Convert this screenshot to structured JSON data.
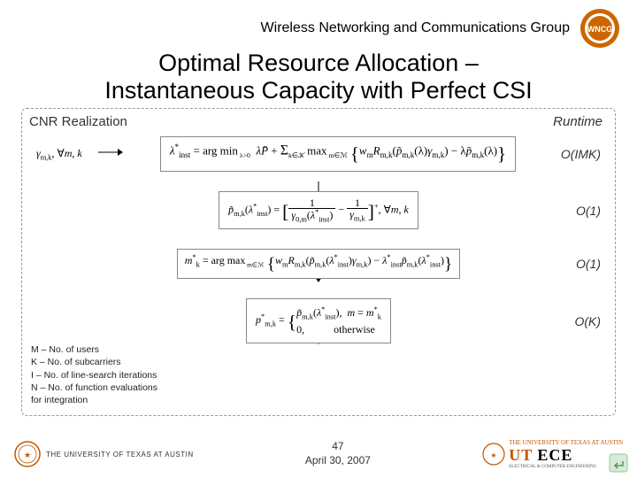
{
  "header": {
    "group_name": "Wireless Networking and Communications Group",
    "logo_label": "WNCG"
  },
  "title": {
    "line1": "Optimal Resource Allocation –",
    "line2": "Instantaneous Capacity with Perfect CSI"
  },
  "labels": {
    "cnr": "CNR Realization",
    "runtime": "Runtime"
  },
  "equations": {
    "eq1": {
      "text": "γₘ,ₖ, ∀m, k  →  λ*ᵢₙₛₜ = arg min  λP̄ + Σ  max { wₘ Rₘ,ₖ(p̃ₘ,ₖ(λ)γₘ,ₖ) − λ p̃ₘ,ₖ(λ) }   (λ>0, k∈K, m∈M)",
      "complexity": "O(IMK)"
    },
    "eq2": {
      "text": "p̃ₘ,ₖ(λ*ᵢₙₛₜ) = [ 1 / γ₀,ₘ(λ*ᵢₙₛₜ)  −  1 / γₘ,ₖ ]⁺ , ∀m, k",
      "complexity": "O(1)"
    },
    "eq3": {
      "text": "m*ₖ = arg max { wₘ Rₘ,ₖ(p̃ₘ,ₖ(λ*ᵢₙₛₜ)γₘ,ₖ) − λ*ᵢₙₛₜ p̃ₘ,ₖ(λ*ᵢₙₛₜ) }   (m∈M)",
      "complexity": "O(1)"
    },
    "eq4": {
      "text": "p*ₘ,ₖ = { p̃ₘ,ₖ(λ*ᵢₙₛₜ), m = m*ₖ ;  0, otherwise",
      "complexity": "O(K)"
    }
  },
  "legend": {
    "l1": "M – No. of users",
    "l2": "K – No. of subcarriers",
    "l3": "I – No. of line-search iterations",
    "l4": "N – No. of function evaluations",
    "l5": "for integration"
  },
  "footer": {
    "ut_wordmark": "THE UNIVERSITY OF TEXAS AT AUSTIN",
    "page_num": "47",
    "date": "April 30, 2007",
    "ece_ut": "THE UNIVERSITY OF TEXAS AT AUSTIN",
    "ece_main": "ECE",
    "ece_sub": "ELECTRICAL & COMPUTER ENGINEERING"
  }
}
